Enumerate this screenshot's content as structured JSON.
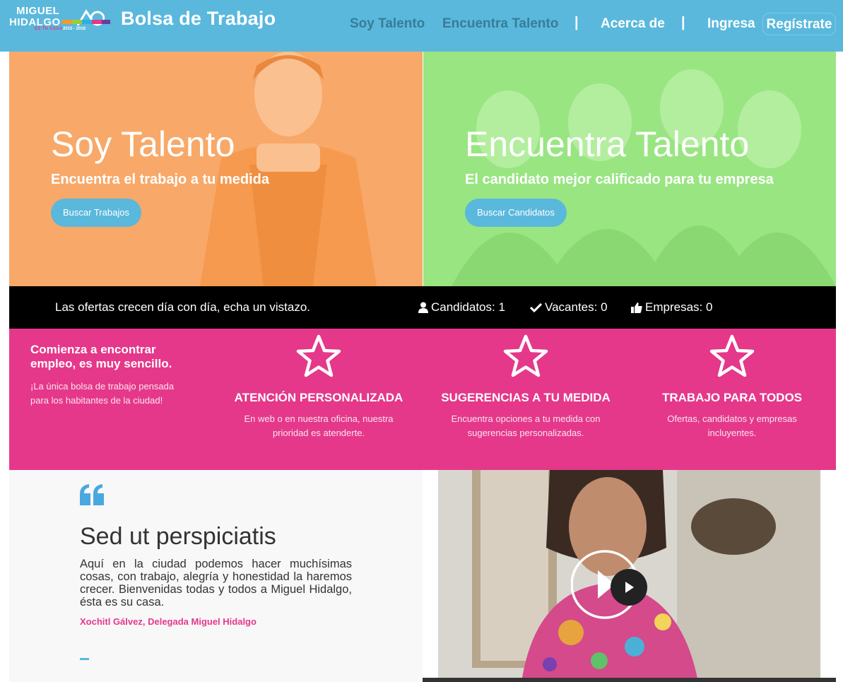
{
  "nav": {
    "logo_line1": "MIGUEL",
    "logo_line2": "HIDALGO",
    "logo_sub": "ES TU CASA",
    "logo_years": "2015 - 2018",
    "brand_title": "Bolsa de Trabajo",
    "links": [
      {
        "label": "Soy Talento"
      },
      {
        "label": "Encuentra Talento"
      },
      {
        "label": "Acerca de"
      },
      {
        "label": "Ingresa"
      }
    ],
    "separator": "|",
    "register_label": "Regístrate"
  },
  "hero": {
    "left": {
      "title": "Soy Talento",
      "subtitle": "Encuentra el trabajo a tu medida",
      "button": "Buscar Trabajos"
    },
    "right": {
      "title": "Encuentra Talento",
      "subtitle": "El candidato mejor calificado para tu empresa",
      "button": "Buscar Candidatos"
    }
  },
  "stats": {
    "tagline": "Las ofertas crecen día con día, echa un vistazo.",
    "candidates": "Candidatos: 1",
    "vacancies": "Vacantes: 0",
    "companies": "Empresas: 0"
  },
  "features": {
    "intro_title": "Comienza a encontrar empleo, es muy sencillo.",
    "intro_text": "¡La única bolsa de trabajo pensada para los habitantes de la ciudad!",
    "items": [
      {
        "title": "ATENCIÓN PERSONALIZADA",
        "text": "En web o en nuestra oficina, nuestra prioridad es atenderte.",
        "icon": "star-outline-icon"
      },
      {
        "title": "SUGERENCIAS A TU MEDIDA",
        "text": "Encuentra opciones a tu medida con sugerencias personalizadas.",
        "icon": "star-outline-icon"
      },
      {
        "title": "TRABAJO PARA TODOS",
        "text": "Ofertas, candidatos y empresas incluyentes.",
        "icon": "star-outline-icon"
      }
    ]
  },
  "quote": {
    "heading": "Sed ut perspiciatis",
    "text": "Aquí en la ciudad podemos hacer muchísimas cosas, con trabajo, alegría y honestidad la haremos crecer. Bienvenidas todas y todos a Miguel Hidalgo, ésta es su casa.",
    "author": "Xochitl Gálvez, Delegada Miguel Hidalgo"
  },
  "colors": {
    "nav": "#5ab8dc",
    "hero_left": "#f9a35e",
    "hero_right": "#99e582",
    "features": "#e5388a",
    "stats": "#000000"
  }
}
